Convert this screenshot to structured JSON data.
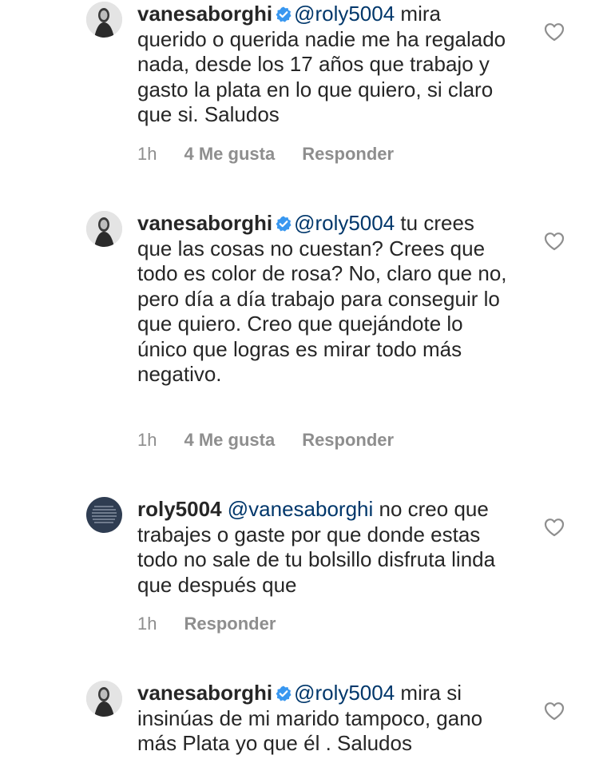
{
  "comments": [
    {
      "username": "vanesaborghi",
      "verified": true,
      "avatar_icon": "profile-photo",
      "mention": "@roly5004",
      "text": " mira querido o querida nadie me ha regalado nada, desde los 17 años que trabajo y gasto la plata en lo que quiero, si claro que si. Saludos",
      "time": "1h",
      "likes": "4 Me gusta",
      "reply_label": "Responder"
    },
    {
      "username": "vanesaborghi",
      "verified": true,
      "avatar_icon": "profile-photo",
      "mention": "@roly5004",
      "text": " tu crees que las cosas no cuestan? Crees que todo es color de rosa? No, claro que no, pero día a día trabajo para conseguir lo que quiero. Creo que quejándote lo único que logras es mirar todo más negativo.",
      "time": "1h",
      "likes": "4 Me gusta",
      "reply_label": "Responder"
    },
    {
      "username": "roly5004",
      "verified": false,
      "avatar_icon": "profile-photo",
      "mention": "@vanesaborghi",
      "text": " no creo que trabajes o gaste por que donde estas todo no sale de tu bolsillo disfruta linda que después que",
      "time": "1h",
      "likes": "",
      "reply_label": "Responder"
    },
    {
      "username": "vanesaborghi",
      "verified": true,
      "avatar_icon": "profile-photo",
      "mention": "@roly5004",
      "text": " mira si insinúas de mi marido tampoco, gano más  Plata yo que él . Saludos",
      "time": "",
      "likes": "",
      "reply_label": ""
    }
  ],
  "icons": {
    "like": "heart-outline-icon",
    "verified": "verified-badge-icon"
  },
  "colors": {
    "text": "#262626",
    "mention": "#00376b",
    "meta": "#8e8e8e",
    "verified": "#3897f0"
  }
}
